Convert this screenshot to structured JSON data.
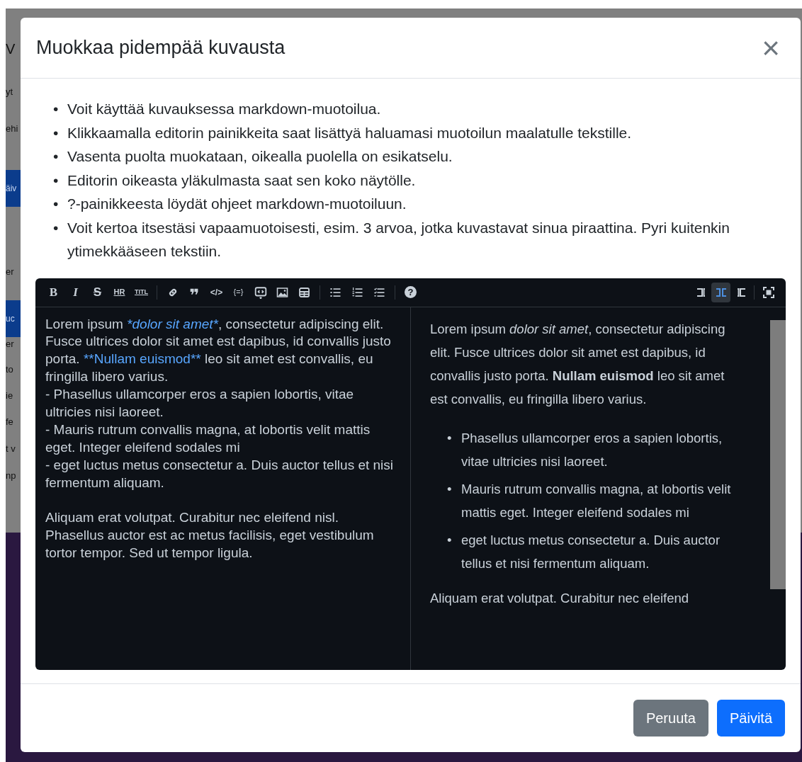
{
  "background_fragments": [
    {
      "text": "V",
      "kind": "heading"
    },
    {
      "text": "yt",
      "kind": "text"
    },
    {
      "text": "ehi",
      "kind": "text"
    },
    {
      "text": "äiv",
      "kind": "button"
    },
    {
      "text": "er",
      "kind": "text"
    },
    {
      "text": "uc",
      "kind": "button"
    },
    {
      "text": "er",
      "kind": "text"
    },
    {
      "text": "to",
      "kind": "text"
    },
    {
      "text": "ie",
      "kind": "text"
    },
    {
      "text": "fe",
      "kind": "text"
    },
    {
      "text": "t v",
      "kind": "text"
    },
    {
      "text": "np",
      "kind": "text"
    }
  ],
  "modal": {
    "title": "Muokkaa pidempää kuvausta",
    "close": "×",
    "bullet": "•",
    "instructions": [
      "Voit käyttää kuvauksessa markdown-muotoilua.",
      "Klikkaamalla editorin painikkeita saat lisättyä haluamasi muotoilun maalatulle tekstille.",
      "Vasenta puolta muokataan, oikealla puolella on esikatselu.",
      "Editorin oikeasta yläkulmasta saat sen koko näytölle.",
      "?-painikkeesta löydät ohjeet markdown-muotoiluun.",
      "Voit kertoa itsestäsi vapaamuotoisesti, esim. 3 arvoa, jotka kuvastavat sinua piraattina. Pyri kuitenkin ytimekkääseen tekstiin."
    ],
    "toolbar": {
      "groups": [
        [
          {
            "kind": "bold",
            "glyph": "B"
          },
          {
            "kind": "italic",
            "glyph": "I"
          },
          {
            "kind": "strike",
            "glyph": "S"
          },
          {
            "kind": "hr",
            "glyph": "HR"
          },
          {
            "kind": "heading",
            "glyph": "TITL"
          }
        ],
        [
          {
            "kind": "link"
          },
          {
            "kind": "quote",
            "glyph": "❞"
          },
          {
            "kind": "code",
            "glyph": "</>"
          },
          {
            "kind": "codeblock",
            "glyph": "{=}"
          },
          {
            "kind": "comment"
          },
          {
            "kind": "image"
          },
          {
            "kind": "table"
          }
        ],
        [
          {
            "kind": "ul"
          },
          {
            "kind": "ol"
          },
          {
            "kind": "tasks"
          }
        ],
        [
          {
            "kind": "help",
            "glyph": "?"
          }
        ]
      ],
      "views": [
        {
          "kind": "edit",
          "selected": false
        },
        {
          "kind": "split",
          "selected": true
        },
        {
          "kind": "preview",
          "selected": false
        }
      ]
    },
    "source": [
      [
        [
          {
            "kind": "plain",
            "text": "Lorem ipsum "
          },
          {
            "kind": "italic",
            "text": "*dolor sit amet*"
          },
          {
            "kind": "plain",
            "text": ", consectetur adipiscing elit. Fusce ultrices dolor sit amet est dapibus, id convallis justo porta. "
          },
          {
            "kind": "bold",
            "text": "**Nullam euismod**"
          },
          {
            "kind": "plain",
            "text": " leo sit amet est convallis, eu fringilla libero varius."
          }
        ],
        [
          {
            "kind": "plain",
            "text": "- Phasellus ullamcorper eros a sapien lobortis, vitae ultricies nisi laoreet."
          }
        ],
        [
          {
            "kind": "plain",
            "text": "- Mauris rutrum convallis magna, at lobortis velit mattis eget. Integer eleifend sodales mi"
          }
        ],
        [
          {
            "kind": "plain",
            "text": "- eget luctus metus consectetur a. Duis auctor tellus et nisi fermentum aliquam."
          }
        ]
      ],
      [
        [
          {
            "kind": "plain",
            "text": "Aliquam erat volutpat. Curabitur nec eleifend nisl. Phasellus auctor est ac metus facilisis, eget vestibulum tortor tempor. Sed ut tempor ligula."
          }
        ]
      ]
    ],
    "preview": {
      "paragraph": "Lorem ipsum *dolor sit amet*, consectetur adipiscing elit. Fusce ultrices dolor sit amet est dapibus, id convallis justo porta. **Nullam euismod** leo sit amet est convallis, eu fringilla libero varius.",
      "bullets": [
        "Phasellus ullamcorper eros a sapien lobortis, vitae ultricies nisi laoreet.",
        "Mauris rutrum convallis magna, at lobortis velit mattis eget. Integer eleifend sodales mi",
        "eget luctus metus consectetur a. Duis auctor tellus et nisi fermentum aliquam."
      ],
      "last_line": "Aliquam erat volutpat. Curabitur nec eleifend"
    },
    "buttons": [
      {
        "label": "Peruuta",
        "kind": "secondary"
      },
      {
        "label": "Päivitä",
        "kind": "primary"
      }
    ]
  }
}
